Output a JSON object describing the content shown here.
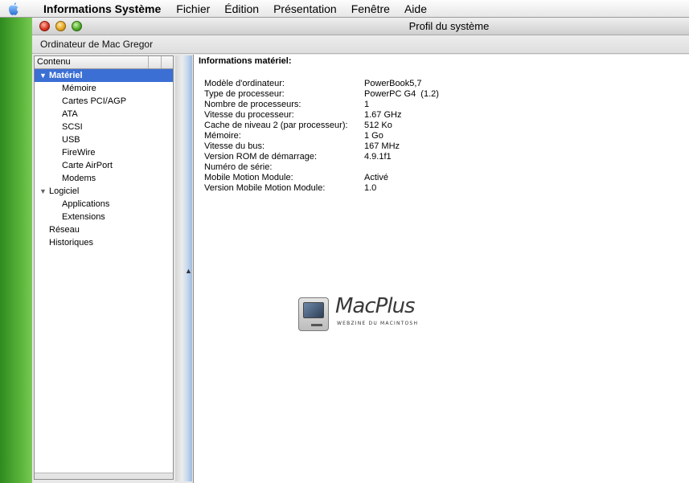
{
  "menubar": {
    "apple_icon": "apple-icon",
    "app_name": "Informations Système",
    "items": [
      "Fichier",
      "Édition",
      "Présentation",
      "Fenêtre",
      "Aide"
    ]
  },
  "window": {
    "title": "Profil du système",
    "computer_name": "Ordinateur de Mac Gregor"
  },
  "sidebar": {
    "header": "Contenu",
    "groups": [
      {
        "label": "Matériel",
        "expanded": true,
        "selected": true,
        "items": [
          "Mémoire",
          "Cartes PCI/AGP",
          "ATA",
          "SCSI",
          "USB",
          "FireWire",
          "Carte AirPort",
          "Modems"
        ]
      },
      {
        "label": "Logiciel",
        "expanded": true,
        "items": [
          "Applications",
          "Extensions"
        ]
      },
      {
        "label": "Réseau"
      },
      {
        "label": "Historiques"
      }
    ]
  },
  "details": {
    "title": "Informations matériel:",
    "rows": [
      {
        "key": "Modèle d'ordinateur:",
        "value": "PowerBook5,7"
      },
      {
        "key": "Type de processeur:",
        "value": "PowerPC G4  (1.2)"
      },
      {
        "key": "Nombre de processeurs:",
        "value": "1"
      },
      {
        "key": "Vitesse du processeur:",
        "value": "1.67 GHz"
      },
      {
        "key": "Cache de niveau 2 (par processeur):",
        "value": "512 Ko"
      },
      {
        "key": "Mémoire:",
        "value": "1 Go"
      },
      {
        "key": "Vitesse du bus:",
        "value": "167 MHz"
      },
      {
        "key": "Version ROM de démarrage:",
        "value": "4.9.1f1"
      },
      {
        "key": "Numéro de série:",
        "value": ""
      },
      {
        "key": "Mobile Motion Module:",
        "value": "Activé"
      },
      {
        "key": "Version Mobile Motion Module:",
        "value": "1.0"
      }
    ]
  },
  "logo": {
    "name": "MacPlus",
    "tagline": "WEBZINE DU MACINTOSH"
  }
}
